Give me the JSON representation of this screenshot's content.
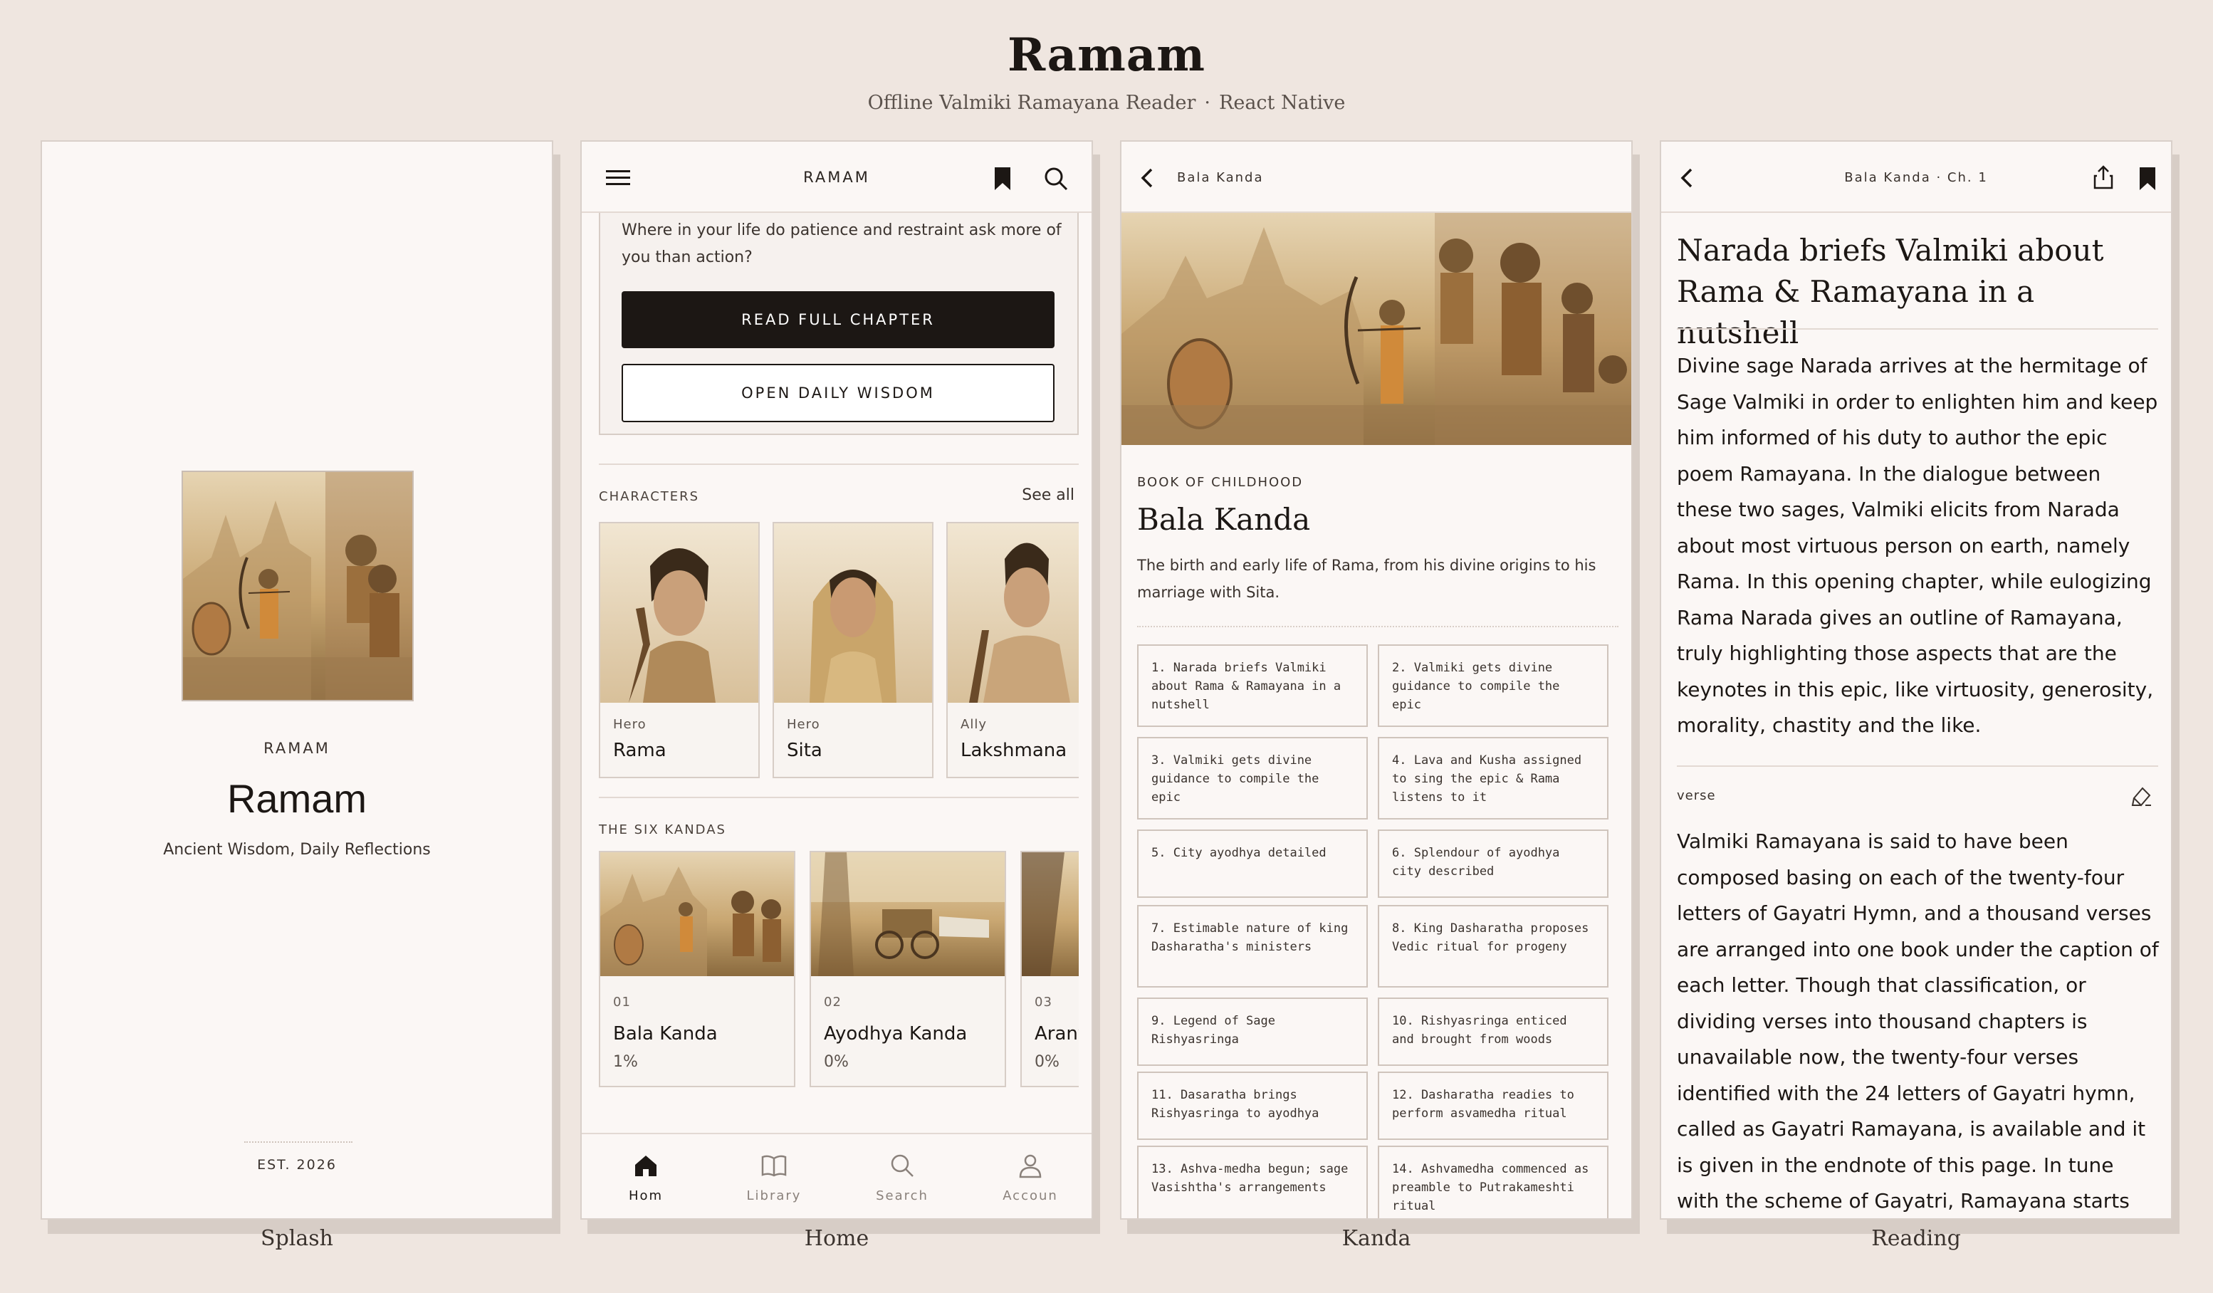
{
  "header": {
    "title": "Ramam",
    "subtitle_left": "Offline Valmiki Ramayana Reader",
    "subtitle_sep": "·",
    "subtitle_right": "React Native"
  },
  "captions": {
    "splash": "Splash",
    "home": "Home",
    "kanda": "Kanda",
    "reading": "Reading"
  },
  "splash": {
    "brand": "RAMAM",
    "title": "Ramam",
    "tagline": "Ancient Wisdom, Daily Reflections",
    "est": "EST. 2026"
  },
  "home": {
    "app_title": "RAMAM",
    "prompt": "Where in your life do patience and restraint ask more of you than action?",
    "read_full_chapter": "READ FULL CHAPTER",
    "open_daily_wisdom": "OPEN DAILY WISDOM",
    "characters_label": "CHARACTERS",
    "see_all": "See all",
    "characters": [
      {
        "role": "Hero",
        "name": "Rama"
      },
      {
        "role": "Hero",
        "name": "Sita"
      },
      {
        "role": "Ally",
        "name": "Lakshmana"
      }
    ],
    "kandas_label": "THE SIX KANDAS",
    "kandas": [
      {
        "num": "01",
        "name": "Bala Kanda",
        "progress": "1%"
      },
      {
        "num": "02",
        "name": "Ayodhya Kanda",
        "progress": "0%"
      },
      {
        "num": "03",
        "name": "Arany",
        "progress": "0%"
      }
    ],
    "tabs": [
      {
        "label": "Hom",
        "icon": "home-icon"
      },
      {
        "label": "Library",
        "icon": "book-icon"
      },
      {
        "label": "Search",
        "icon": "search-icon"
      },
      {
        "label": "Accoun",
        "icon": "user-icon"
      }
    ]
  },
  "kanda": {
    "breadcrumb": "Bala Kanda",
    "kicker": "BOOK OF CHILDHOOD",
    "title": "Bala Kanda",
    "description": "The birth and early life of Rama, from his divine origins to his marriage with Sita.",
    "chapters": [
      "1. Narada briefs Valmiki about Rama & Ramayana in a nutshell",
      "2. Valmiki gets divine guidance to compile the epic",
      "3. Valmiki gets divine guidance to compile the epic",
      "4. Lava and Kusha assigned to sing the epic & Rama listens to it",
      "5. City ayodhya detailed",
      "6. Splendour of ayodhya city described",
      "7. Estimable nature of king Dasharatha's ministers",
      "8. King Dasharatha proposes Vedic ritual for progeny",
      "9. Legend of Sage Rishyasringa",
      "10. Rishyasringa enticed and brought from woods",
      "11. Dasaratha brings Rishyasringa to ayodhya",
      "12. Dasharatha readies to perform asvamedha ritual",
      "13. Ashva-medha begun; sage Vasishtha's arrangements",
      "14. Ashvamedha commenced as preamble to Putrakameshti ritual"
    ]
  },
  "reading": {
    "breadcrumb": "Bala Kanda · Ch. 1",
    "title": "Narada briefs Valmiki about Rama & Ramayana in a nutshell",
    "summary": "Divine sage Narada arrives at the hermitage of Sage Valmiki in order to enlighten him and keep him informed of his duty to author the epic poem Ramayana. In the dialogue between these two sages, Valmiki elicits from Narada about most virtuous person on earth, namely Rama. In this opening chapter, while eulogizing Rama Narada gives an outline of Ramayana, truly highlighting those aspects that are the keynotes in this epic, like virtuosity, generosity, morality, chastity and the like.",
    "verse_label": "verse",
    "verse_text": "Valmiki Ramayana is said to have been composed basing on each of the twenty-four letters of Gayatri Hymn, and a thousand verses are arranged into one book under the caption of each letter. Though that classification, or dividing verses into thousand chapters is unavailable now, the twenty-four verses identified with the 24 letters of Gayatri hymn, called as Gayatri Ramayana, is available and it is given in the endnote of this page. In tune with the scheme of Gayatri, Ramayana starts the first verse with"
  }
}
